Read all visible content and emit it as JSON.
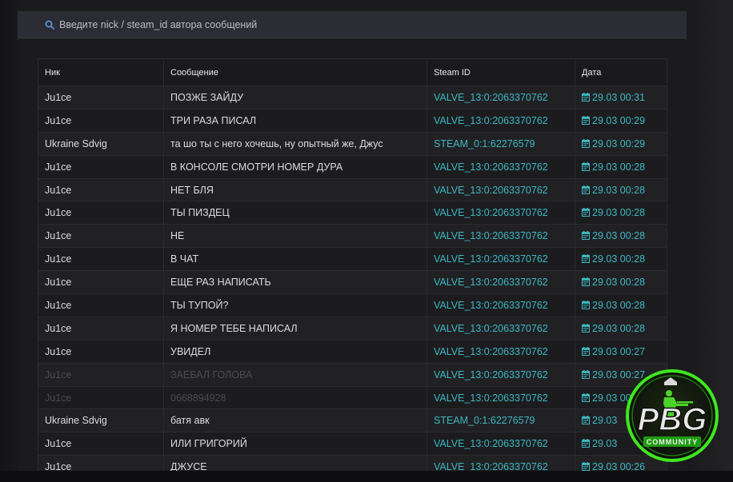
{
  "search": {
    "placeholder": "Введите nick / steam_id автора сообщений",
    "value": ""
  },
  "table": {
    "columns": [
      "Ник",
      "Сообщение",
      "Steam ID",
      "Дата"
    ],
    "rows": [
      {
        "nick": "Ju1ce",
        "message": "ПОЗЖЕ ЗАЙДУ",
        "steam_id": "VALVE_13:0:2063370762",
        "date": "29.03 00:31"
      },
      {
        "nick": "Ju1ce",
        "message": "ТРИ РАЗА ПИСАЛ",
        "steam_id": "VALVE_13:0:2063370762",
        "date": "29.03 00:29"
      },
      {
        "nick": "Ukraine Sdvig",
        "message": "та шо ты с него хочешь, ну опытный же, Джус",
        "steam_id": "STEAM_0:1:62276579",
        "date": "29.03 00:29"
      },
      {
        "nick": "Ju1ce",
        "message": "В КОНСОЛЕ СМОТРИ НОМЕР ДУРА",
        "steam_id": "VALVE_13:0:2063370762",
        "date": "29.03 00:28"
      },
      {
        "nick": "Ju1ce",
        "message": "НЕТ БЛЯ",
        "steam_id": "VALVE_13:0:2063370762",
        "date": "29.03 00:28"
      },
      {
        "nick": "Ju1ce",
        "message": "ТЫ ПИЗДЕЦ",
        "steam_id": "VALVE_13:0:2063370762",
        "date": "29.03 00:28"
      },
      {
        "nick": "Ju1ce",
        "message": "НЕ",
        "steam_id": "VALVE_13:0:2063370762",
        "date": "29.03 00:28"
      },
      {
        "nick": "Ju1ce",
        "message": "В ЧАТ",
        "steam_id": "VALVE_13:0:2063370762",
        "date": "29.03 00:28"
      },
      {
        "nick": "Ju1ce",
        "message": "ЕЩЕ РАЗ НАПИСАТЬ",
        "steam_id": "VALVE_13:0:2063370762",
        "date": "29.03 00:28"
      },
      {
        "nick": "Ju1ce",
        "message": "ТЫ ТУПОЙ?",
        "steam_id": "VALVE_13:0:2063370762",
        "date": "29.03 00:28"
      },
      {
        "nick": "Ju1ce",
        "message": "Я НОМЕР ТЕБЕ НАПИСАЛ",
        "steam_id": "VALVE_13:0:2063370762",
        "date": "29.03 00:28"
      },
      {
        "nick": "Ju1ce",
        "message": "УВИДЕЛ",
        "steam_id": "VALVE_13:0:2063370762",
        "date": "29.03 00:27"
      },
      {
        "nick": "Ju1ce",
        "message": "ЗАЕБАЛ ГОЛОВА",
        "steam_id": "VALVE_13:0:2063370762",
        "date": "29.03 00:27",
        "faded": true
      },
      {
        "nick": "Ju1ce",
        "message": "0668894928",
        "steam_id": "VALVE_13:0:2063370762",
        "date": "29.03 00",
        "faded": true
      },
      {
        "nick": "Ukraine Sdvig",
        "message": "батя авк",
        "steam_id": "STEAM_0:1:62276579",
        "date": "29.03"
      },
      {
        "nick": "Ju1ce",
        "message": "ИЛИ ГРИГОРИЙ",
        "steam_id": "VALVE_13:0:2063370762",
        "date": "29.03"
      },
      {
        "nick": "Ju1ce",
        "message": "ДЖУСЕ",
        "steam_id": "VALVE_13:0:2063370762",
        "date": "29.03 00:26"
      }
    ]
  },
  "logo": {
    "text": "PBG",
    "subtext": "COMMUNITY",
    "accent_color": "#3ee81e"
  },
  "colors": {
    "steam_id": "#3cb8c2",
    "date": "#3cb8c2",
    "row_odd": "#212124",
    "row_even": "#1c1c1f",
    "search_bar": "#2c2c34"
  },
  "icons": {
    "search": "search-icon",
    "date": "calendar-icon"
  }
}
